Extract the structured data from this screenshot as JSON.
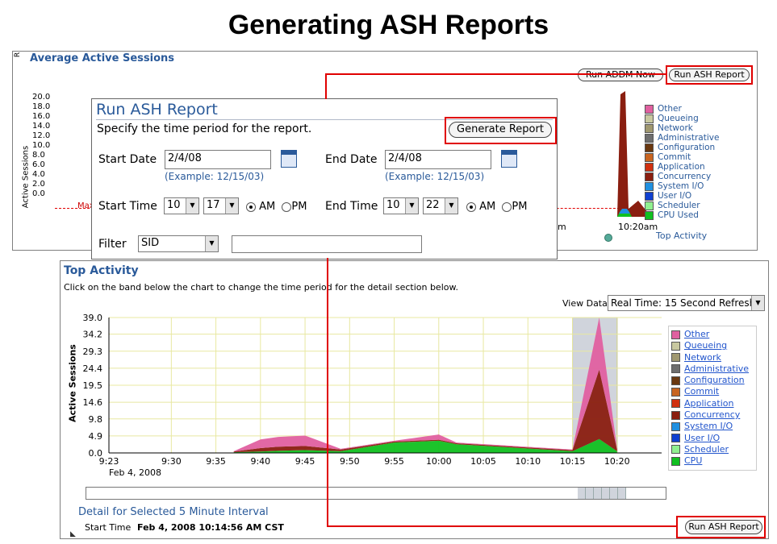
{
  "slide_title": "Generating ASH Reports",
  "top_panel": {
    "title": "Average Active Sessions",
    "corner_char": "R",
    "ylabel": "Active Sessions",
    "yticks": [
      "20.0",
      "18.0",
      "16.0",
      "14.0",
      "12.0",
      "10.0",
      "8.0",
      "6.0",
      "4.0",
      "2.0",
      "0.0"
    ],
    "max_label": "Max",
    "run_addm_label": "Run ADDM Now",
    "run_ash_label": "Run ASH Report",
    "x_partial": "m",
    "x_last": "10:20am",
    "top_activity_link": "Top Activity",
    "legend": [
      {
        "name": "Other",
        "color": "#e060a0"
      },
      {
        "name": "Queueing",
        "color": "#c8c8a0"
      },
      {
        "name": "Network",
        "color": "#a09870"
      },
      {
        "name": "Administrative",
        "color": "#6e6e6e"
      },
      {
        "name": "Configuration",
        "color": "#6a3810"
      },
      {
        "name": "Commit",
        "color": "#c86420"
      },
      {
        "name": "Application",
        "color": "#d03010"
      },
      {
        "name": "Concurrency",
        "color": "#8a1e10"
      },
      {
        "name": "System I/O",
        "color": "#2090e0"
      },
      {
        "name": "User I/O",
        "color": "#1040d0"
      },
      {
        "name": "Scheduler",
        "color": "#90f090"
      },
      {
        "name": "CPU Used",
        "color": "#10c020"
      }
    ]
  },
  "dialog": {
    "title": "Run ASH Report",
    "instruction": "Specify the time period for the report.",
    "generate_label": "Generate Report",
    "start_date_label": "Start Date",
    "start_date_value": "2/4/08",
    "start_example": "(Example: 12/15/03)",
    "end_date_label": "End Date",
    "end_date_value": "2/4/08",
    "end_example": "(Example: 12/15/03)",
    "start_time_label": "Start Time",
    "start_hour": "10",
    "start_min": "17",
    "end_time_label": "End Time",
    "end_hour": "10",
    "end_min": "22",
    "am_label": "AM",
    "pm_label": "PM",
    "start_ampm_selected": "AM",
    "end_ampm_selected": "AM",
    "filter_label": "Filter",
    "filter_select": "SID",
    "filter_value": ""
  },
  "bottom_panel": {
    "title": "Top Activity",
    "instruction": "Click on the band below the chart to change the time period for the detail section below.",
    "view_data_label": "View Data",
    "view_data_value": "Real Time: 15 Second Refresh",
    "detail_title": "Detail for Selected 5 Minute Interval",
    "start_time_label": "Start Time",
    "start_time_value": "Feb 4, 2008 10:14:56 AM CST",
    "run_ash_label": "Run ASH Report",
    "legend": [
      {
        "name": "Other",
        "color": "#e060a0"
      },
      {
        "name": "Queueing",
        "color": "#c8c8a0"
      },
      {
        "name": "Network",
        "color": "#a09870"
      },
      {
        "name": "Administrative",
        "color": "#6e6e6e"
      },
      {
        "name": "Configuration",
        "color": "#6a3810"
      },
      {
        "name": "Commit",
        "color": "#c86420"
      },
      {
        "name": "Application",
        "color": "#d03010"
      },
      {
        "name": "Concurrency",
        "color": "#8a1e10"
      },
      {
        "name": "System I/O",
        "color": "#2090e0"
      },
      {
        "name": "User I/O",
        "color": "#1040d0"
      },
      {
        "name": "Scheduler",
        "color": "#90f090"
      },
      {
        "name": "CPU",
        "color": "#10c020"
      }
    ]
  },
  "chart_data": {
    "type": "area",
    "ylabel": "Active Sessions",
    "yticks": [
      "39.0",
      "34.2",
      "29.3",
      "24.4",
      "19.5",
      "14.6",
      "9.8",
      "4.9",
      "0.0"
    ],
    "ylim": [
      0,
      39
    ],
    "xticks": [
      "9:23",
      "9:30",
      "9:35",
      "9:40",
      "9:45",
      "9:50",
      "9:55",
      "10:00",
      "10:05",
      "10:10",
      "10:15",
      "10:20"
    ],
    "x_date_label": "Feb 4, 2008",
    "grid": true,
    "series": [
      {
        "name": "CPU",
        "x": [
          "9:37",
          "9:40",
          "9:42",
          "9:45",
          "9:49",
          "9:55",
          "10:00",
          "10:02",
          "10:15",
          "10:18",
          "10:20"
        ],
        "values": [
          0.2,
          0.4,
          0.6,
          0.8,
          0.5,
          3.0,
          3.5,
          2.5,
          0.5,
          4.0,
          0.5
        ]
      },
      {
        "name": "Concurrency",
        "x": [
          "9:37",
          "9:40",
          "9:42",
          "9:45",
          "9:49",
          "9:55",
          "10:00",
          "10:02",
          "10:15",
          "10:18",
          "10:20"
        ],
        "values": [
          0.2,
          1.0,
          1.2,
          1.2,
          0.5,
          0.3,
          0.3,
          0.3,
          0.3,
          20.0,
          0.5
        ]
      },
      {
        "name": "Other",
        "x": [
          "9:37",
          "9:40",
          "9:42",
          "9:45",
          "9:49",
          "9:55",
          "10:00",
          "10:02",
          "10:15",
          "10:18",
          "10:20"
        ],
        "values": [
          0.1,
          2.5,
          2.8,
          3.0,
          0.2,
          0.2,
          1.5,
          0.2,
          0.2,
          15.0,
          0.3
        ]
      }
    ]
  }
}
